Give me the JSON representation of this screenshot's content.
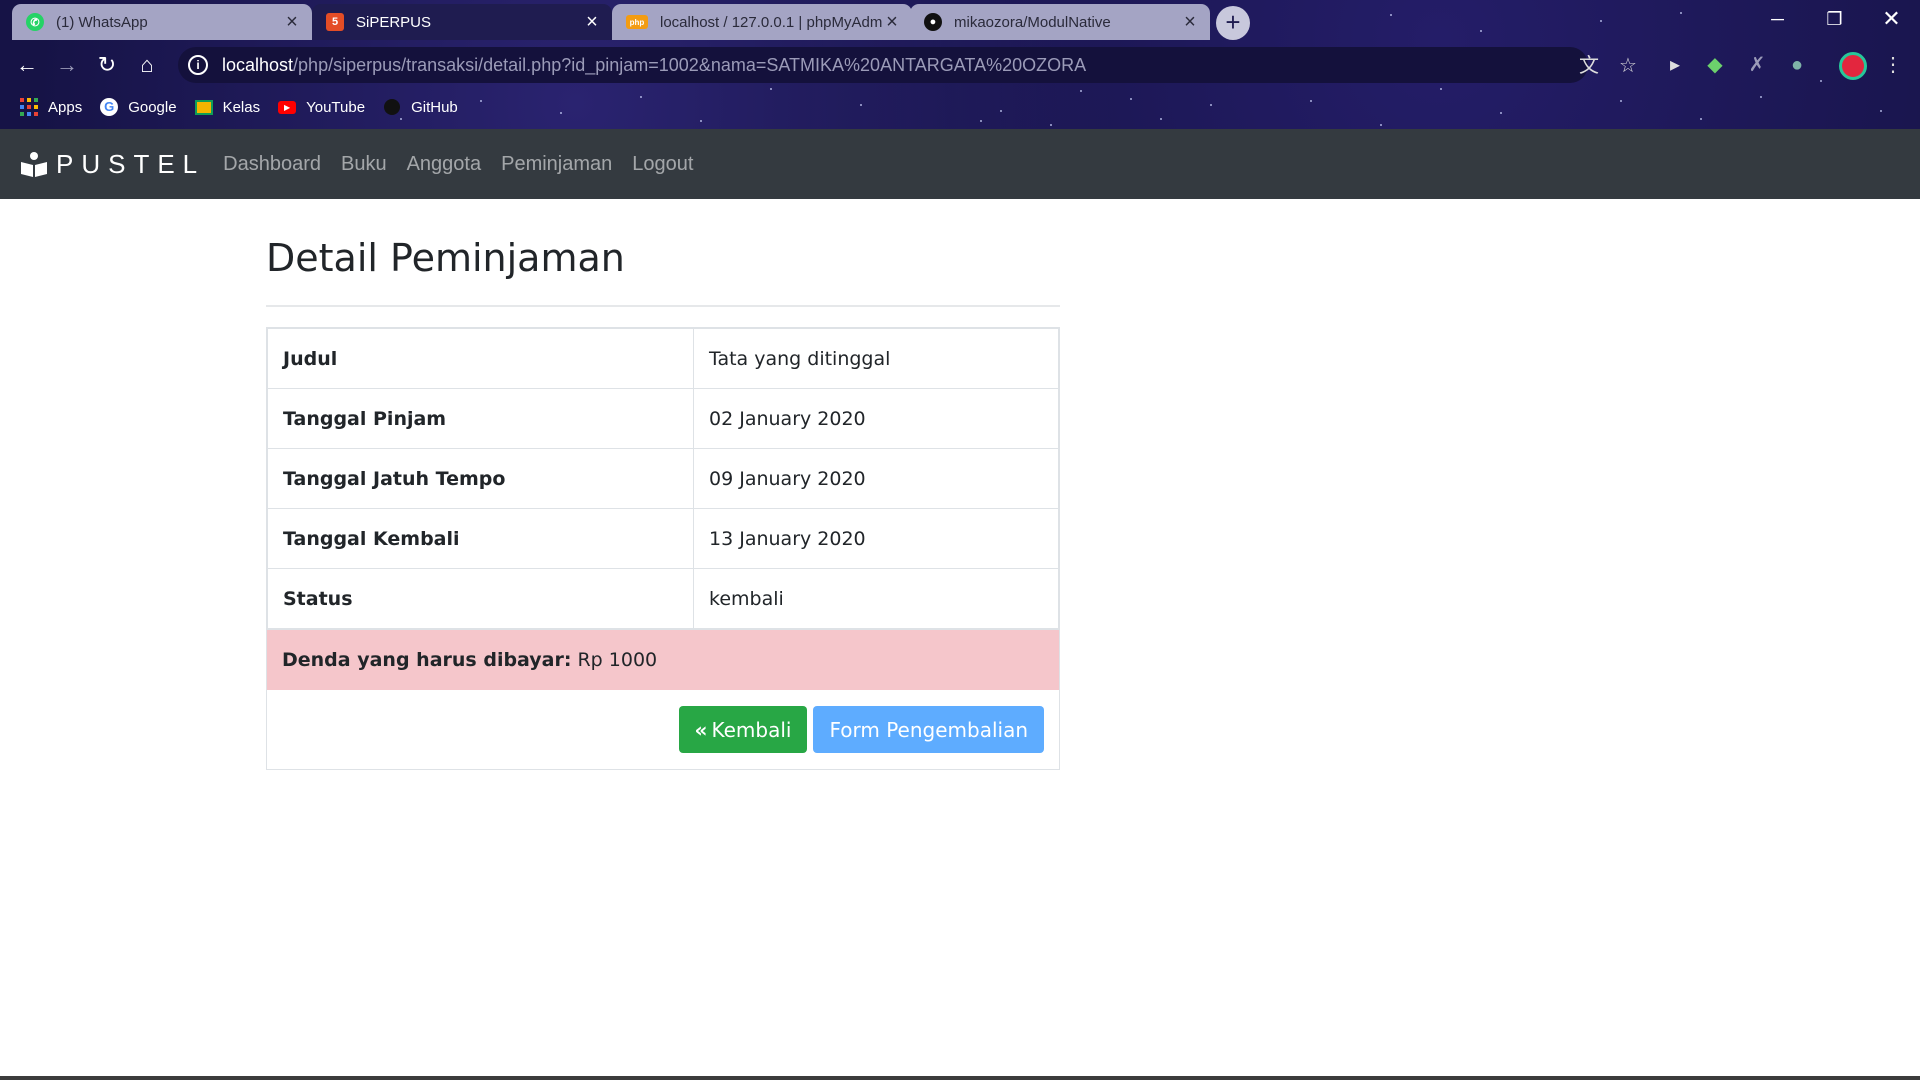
{
  "browser": {
    "tabs": [
      {
        "title": "(1) WhatsApp",
        "icon": "whatsapp-icon",
        "active": false
      },
      {
        "title": "SiPERPUS",
        "icon": "html5-icon",
        "active": true
      },
      {
        "title": "localhost / 127.0.0.1 | phpMyAdmin",
        "icon": "phpmyadmin-icon",
        "active": false
      },
      {
        "title": "mikaozora/ModulNative",
        "icon": "github-icon",
        "active": false
      }
    ],
    "new_tab": "+",
    "url_host": "localhost",
    "url_path": "/php/siperpus/transaksi/detail.php?id_pinjam=1002&nama=SATMIKA%20ANTARGATA%20OZORA",
    "bookmarks": [
      {
        "label": "Apps",
        "icon": "apps-grid-icon"
      },
      {
        "label": "Google",
        "icon": "google-icon"
      },
      {
        "label": "Kelas",
        "icon": "classroom-icon"
      },
      {
        "label": "YouTube",
        "icon": "youtube-icon"
      },
      {
        "label": "GitHub",
        "icon": "github-icon"
      }
    ]
  },
  "navbar": {
    "brand": "PUSTEL",
    "links": [
      "Dashboard",
      "Buku",
      "Anggota",
      "Peminjaman",
      "Logout"
    ]
  },
  "page": {
    "title": "Detail Peminjaman",
    "rows": [
      {
        "label": "Judul",
        "value": "Tata yang ditinggal"
      },
      {
        "label": "Tanggal Pinjam",
        "value": "02 January 2020"
      },
      {
        "label": "Tanggal Jatuh Tempo",
        "value": "09 January 2020"
      },
      {
        "label": "Tanggal Kembali",
        "value": "13 January 2020"
      },
      {
        "label": "Status",
        "value": "kembali"
      }
    ],
    "fine_label": "Denda yang harus dibayar:",
    "fine_value": "Rp 1000",
    "back_button": "Kembali",
    "return_form_button": "Form Pengembalian"
  },
  "colors": {
    "navbar_bg": "#343a40",
    "alert_bg": "#f5c6cb",
    "success": "#28a745",
    "primary": "#5eacff"
  }
}
